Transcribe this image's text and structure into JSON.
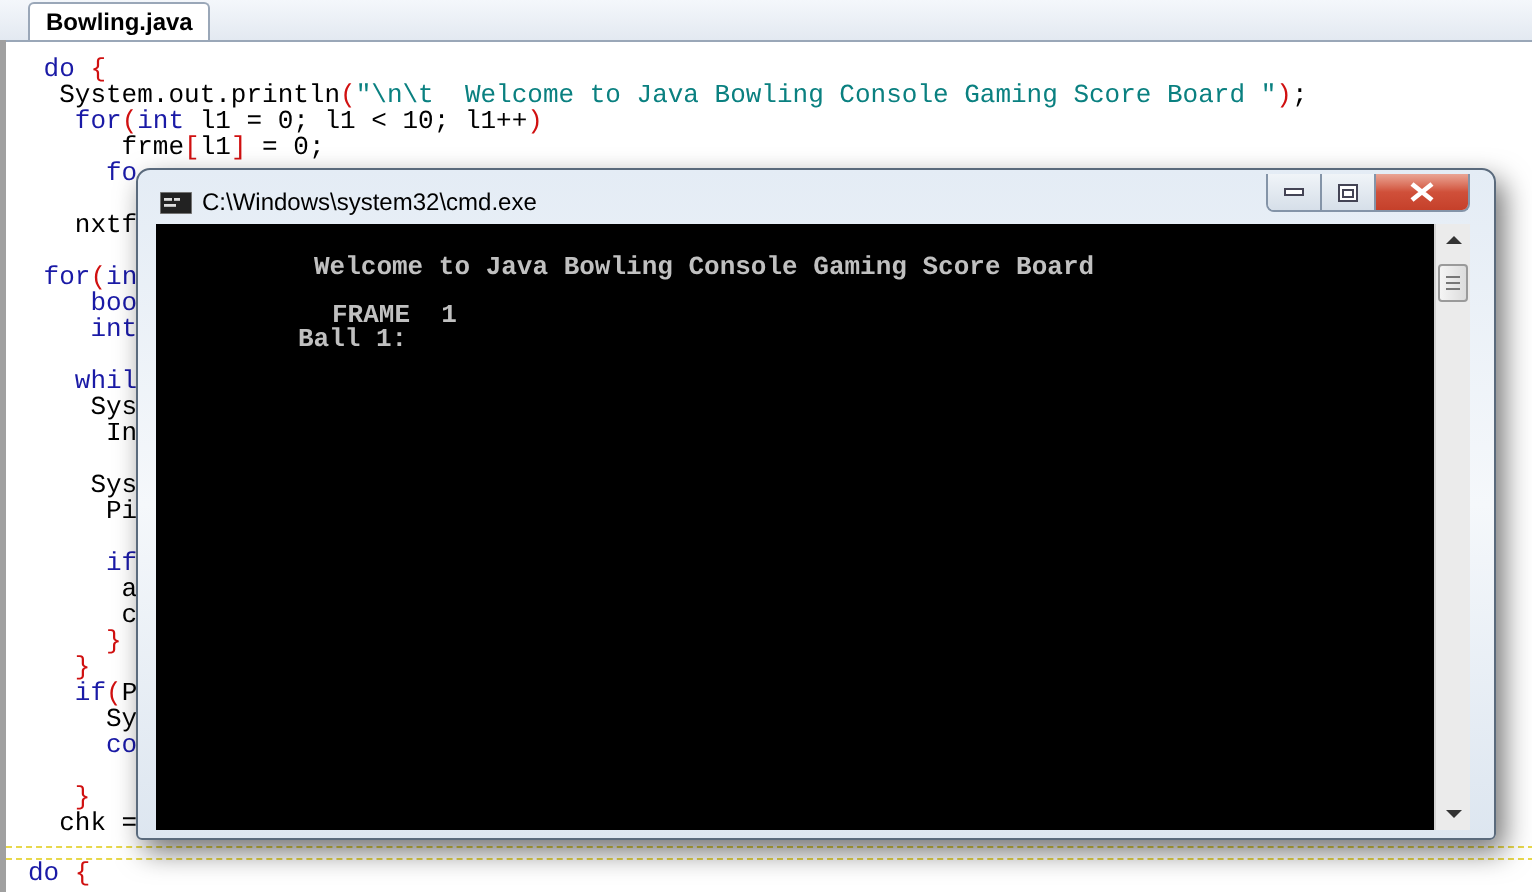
{
  "tab": {
    "label": "Bowling.java",
    "selected": true
  },
  "code_lines": [
    {
      "kind": "code",
      "tokens": [
        {
          "kind": "keyword",
          "text": " do "
        },
        {
          "kind": "bracket",
          "text": "{"
        }
      ]
    },
    {
      "kind": "code",
      "tokens": [
        {
          "kind": "plain",
          "text": "  System.out.println"
        },
        {
          "kind": "bracket",
          "text": "("
        },
        {
          "kind": "string",
          "text": "\"\\n\\t  Welcome to Java Bowling Console Gaming Score Board \""
        },
        {
          "kind": "bracket",
          "text": ")"
        },
        {
          "kind": "plain",
          "text": ";"
        }
      ]
    },
    {
      "kind": "code",
      "tokens": [
        {
          "kind": "keyword",
          "text": "   for"
        },
        {
          "kind": "bracket",
          "text": "("
        },
        {
          "kind": "keyword",
          "text": "int"
        },
        {
          "kind": "plain",
          "text": " l1 = 0; l1 < 10; l1++"
        },
        {
          "kind": "bracket",
          "text": ")"
        }
      ]
    },
    {
      "kind": "code",
      "tokens": [
        {
          "kind": "plain",
          "text": "      frme"
        },
        {
          "kind": "bracket",
          "text": "["
        },
        {
          "kind": "plain",
          "text": "l1"
        },
        {
          "kind": "bracket",
          "text": "]"
        },
        {
          "kind": "plain",
          "text": " = 0;"
        }
      ]
    },
    {
      "kind": "code",
      "tokens": [
        {
          "kind": "keyword",
          "text": "     fo"
        }
      ]
    },
    {
      "kind": "blank"
    },
    {
      "kind": "code",
      "tokens": [
        {
          "kind": "plain",
          "text": "   nxtf"
        }
      ]
    },
    {
      "kind": "blank"
    },
    {
      "kind": "code",
      "tokens": [
        {
          "kind": "keyword",
          "text": " for"
        },
        {
          "kind": "bracket",
          "text": "("
        },
        {
          "kind": "keyword",
          "text": "in"
        }
      ]
    },
    {
      "kind": "code",
      "tokens": [
        {
          "kind": "keyword",
          "text": "    boo"
        }
      ]
    },
    {
      "kind": "code",
      "tokens": [
        {
          "kind": "keyword",
          "text": "    int"
        }
      ]
    },
    {
      "kind": "blank"
    },
    {
      "kind": "code",
      "tokens": [
        {
          "kind": "keyword",
          "text": "   whil"
        }
      ]
    },
    {
      "kind": "code",
      "tokens": [
        {
          "kind": "plain",
          "text": "    Sys"
        }
      ]
    },
    {
      "kind": "code",
      "tokens": [
        {
          "kind": "plain",
          "text": "     In"
        }
      ]
    },
    {
      "kind": "blank"
    },
    {
      "kind": "code",
      "tokens": [
        {
          "kind": "plain",
          "text": "    Sys"
        }
      ]
    },
    {
      "kind": "code",
      "tokens": [
        {
          "kind": "plain",
          "text": "     Pi"
        }
      ]
    },
    {
      "kind": "blank"
    },
    {
      "kind": "code",
      "tokens": [
        {
          "kind": "keyword",
          "text": "     if"
        }
      ]
    },
    {
      "kind": "code",
      "tokens": [
        {
          "kind": "plain",
          "text": "      a"
        }
      ]
    },
    {
      "kind": "code",
      "tokens": [
        {
          "kind": "plain",
          "text": "      c"
        }
      ]
    },
    {
      "kind": "code",
      "tokens": [
        {
          "kind": "bracket",
          "text": "     }"
        }
      ]
    },
    {
      "kind": "code",
      "tokens": [
        {
          "kind": "bracket",
          "text": "   }"
        }
      ]
    },
    {
      "kind": "code",
      "tokens": [
        {
          "kind": "keyword",
          "text": "   if"
        },
        {
          "kind": "bracket",
          "text": "("
        },
        {
          "kind": "plain",
          "text": "P"
        }
      ]
    },
    {
      "kind": "code",
      "tokens": [
        {
          "kind": "plain",
          "text": "     Sy"
        }
      ]
    },
    {
      "kind": "code",
      "tokens": [
        {
          "kind": "keyword",
          "text": "     co"
        }
      ]
    },
    {
      "kind": "blank"
    },
    {
      "kind": "code",
      "tokens": [
        {
          "kind": "bracket",
          "text": "   }"
        }
      ]
    },
    {
      "kind": "code",
      "tokens": [
        {
          "kind": "plain",
          "text": "  chk ="
        }
      ]
    },
    {
      "kind": "separator"
    },
    {
      "kind": "separator"
    },
    {
      "kind": "code",
      "tokens": [
        {
          "kind": "keyword",
          "text": "do "
        },
        {
          "kind": "bracket",
          "text": "{"
        }
      ]
    }
  ],
  "console_window": {
    "title": "C:\\Windows\\system32\\cmd.exe",
    "lines": [
      {
        "text": "Welcome to Java Bowling Console Gaming Score Board",
        "kind": "title"
      },
      {
        "text": "FRAME  1",
        "kind": "frame"
      },
      {
        "text": "Ball 1:",
        "kind": "prompt"
      }
    ]
  }
}
